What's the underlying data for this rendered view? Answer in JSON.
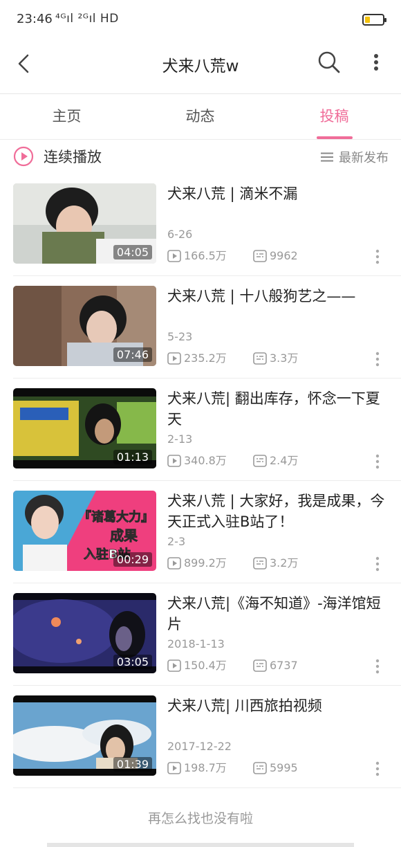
{
  "status_bar": {
    "time": "23:46",
    "signal_text": "⁴ᴳıl ²ᴳıl HD",
    "battery_color": "#f4c20d",
    "battery_level": 0.3
  },
  "nav": {
    "title": "犬来八荒w",
    "icons": [
      "back-arrow-icon",
      "search-icon",
      "more-vertical-icon"
    ]
  },
  "tabs": [
    {
      "label": "主页",
      "active": false
    },
    {
      "label": "动态",
      "active": false
    },
    {
      "label": "投稿",
      "active": true
    }
  ],
  "accent_color": "#f06d99",
  "playbar": {
    "label": "连续播放",
    "sort_label": "最新发布"
  },
  "videos": [
    {
      "title": "犬来八荒 | 滴米不漏",
      "date": "6-26",
      "duration": "04:05",
      "views": "166.5万",
      "danmaku": "9962"
    },
    {
      "title": "犬来八荒 | 十八般狗艺之——",
      "date": "5-23",
      "duration": "07:46",
      "views": "235.2万",
      "danmaku": "3.3万"
    },
    {
      "title": "犬来八荒| 翻出库存，怀念一下夏天",
      "date": "2-13",
      "duration": "01:13",
      "views": "340.8万",
      "danmaku": "2.4万"
    },
    {
      "title": "犬来八荒 | 大家好，我是成果，今天正式入驻B站了！",
      "date": "2-3",
      "duration": "00:29",
      "views": "899.2万",
      "danmaku": "3.2万"
    },
    {
      "title": "犬来八荒|《海不知道》-海洋馆短片",
      "date": "2018-1-13",
      "duration": "03:05",
      "views": "150.4万",
      "danmaku": "6737"
    },
    {
      "title": "犬来八荒| 川西旅拍视频",
      "date": "2017-12-22",
      "duration": "01:39",
      "views": "198.7万",
      "danmaku": "5995"
    }
  ],
  "thumb_texts": {
    "v4_overlay_1": "『诸葛大力』",
    "v4_overlay_2": "成果",
    "v4_overlay_3": "入驻B站"
  },
  "footer": {
    "end_text": "再怎么找也没有啦"
  }
}
